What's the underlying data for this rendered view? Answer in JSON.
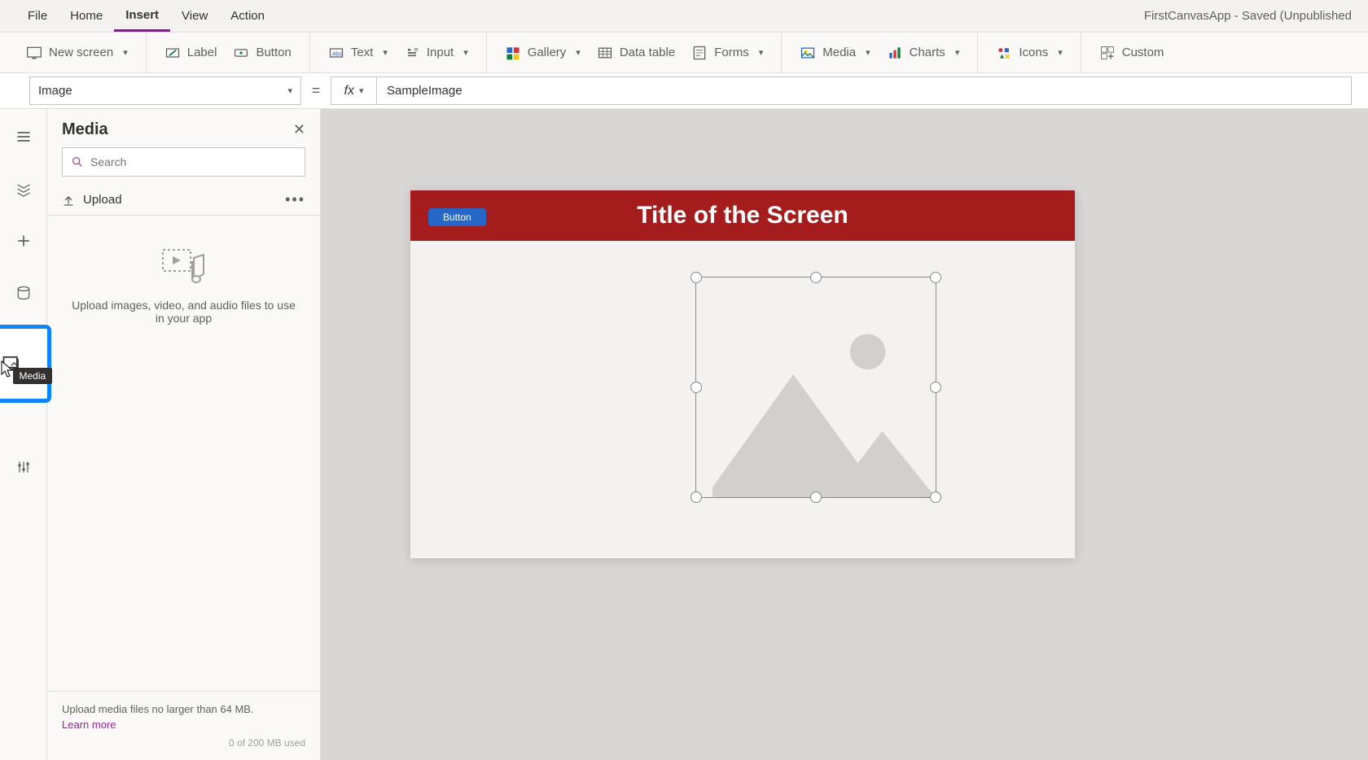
{
  "menu": {
    "file": "File",
    "home": "Home",
    "insert": "Insert",
    "view": "View",
    "action": "Action",
    "active": "insert",
    "app_title": "FirstCanvasApp - Saved (Unpublished"
  },
  "ribbon": {
    "new_screen": "New screen",
    "label": "Label",
    "button": "Button",
    "text": "Text",
    "input": "Input",
    "gallery": "Gallery",
    "data_table": "Data table",
    "forms": "Forms",
    "media": "Media",
    "charts": "Charts",
    "icons": "Icons",
    "custom": "Custom"
  },
  "formula": {
    "property": "Image",
    "equals": "=",
    "fx": "fx",
    "value": "SampleImage"
  },
  "sidepanel": {
    "title": "Media",
    "search_placeholder": "Search",
    "upload": "Upload",
    "empty_msg": "Upload images, video, and audio files to use in your app",
    "footer_msg": "Upload media files no larger than 64 MB.",
    "learn_more": "Learn more",
    "usage": "0 of 200 MB used"
  },
  "rail": {
    "tooltip_media": "Media"
  },
  "canvas": {
    "screen_title": "Title of the Screen",
    "button_label": "Button"
  },
  "colors": {
    "accent_purple": "#742774",
    "header_red": "#a51c1c",
    "button_blue": "#2767c7",
    "highlight_blue": "#0a84ff"
  }
}
